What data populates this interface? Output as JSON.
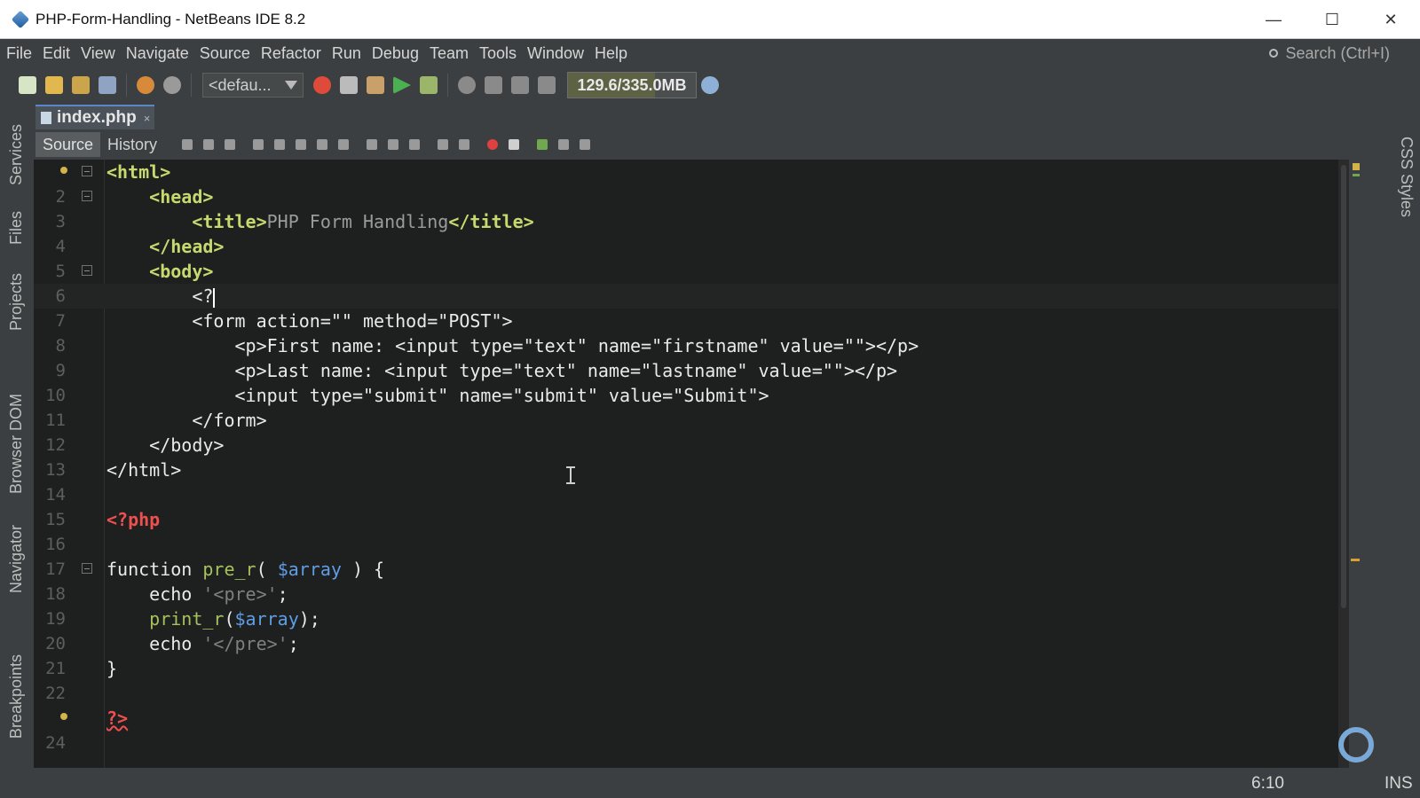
{
  "window": {
    "title": "PHP-Form-Handling - NetBeans IDE 8.2"
  },
  "menu": [
    "File",
    "Edit",
    "View",
    "Navigate",
    "Source",
    "Refactor",
    "Run",
    "Debug",
    "Team",
    "Tools",
    "Window",
    "Help"
  ],
  "search": {
    "placeholder": "Search (Ctrl+I)"
  },
  "toolbar": {
    "config_value": "<defau...",
    "memory": "129.6/335.0MB"
  },
  "side_tabs": {
    "left": [
      "Services",
      "Files",
      "Projects",
      "Browser DOM",
      "Navigator",
      "Breakpoints"
    ],
    "right": [
      "CSS Styles"
    ]
  },
  "editor": {
    "tab_name": "index.php",
    "tab_close": "×",
    "view_tabs": [
      "Source",
      "History"
    ],
    "current_line": 6
  },
  "status": {
    "caret_position": "6:10",
    "insert_mode": "INS"
  },
  "colors": {
    "background": "#1e1f1f",
    "tag": "#e8bf6a",
    "php": "#ee4f4f",
    "function": "#a5c25c",
    "variable": "#5f9ee6",
    "string": "#7f7f7f"
  }
}
